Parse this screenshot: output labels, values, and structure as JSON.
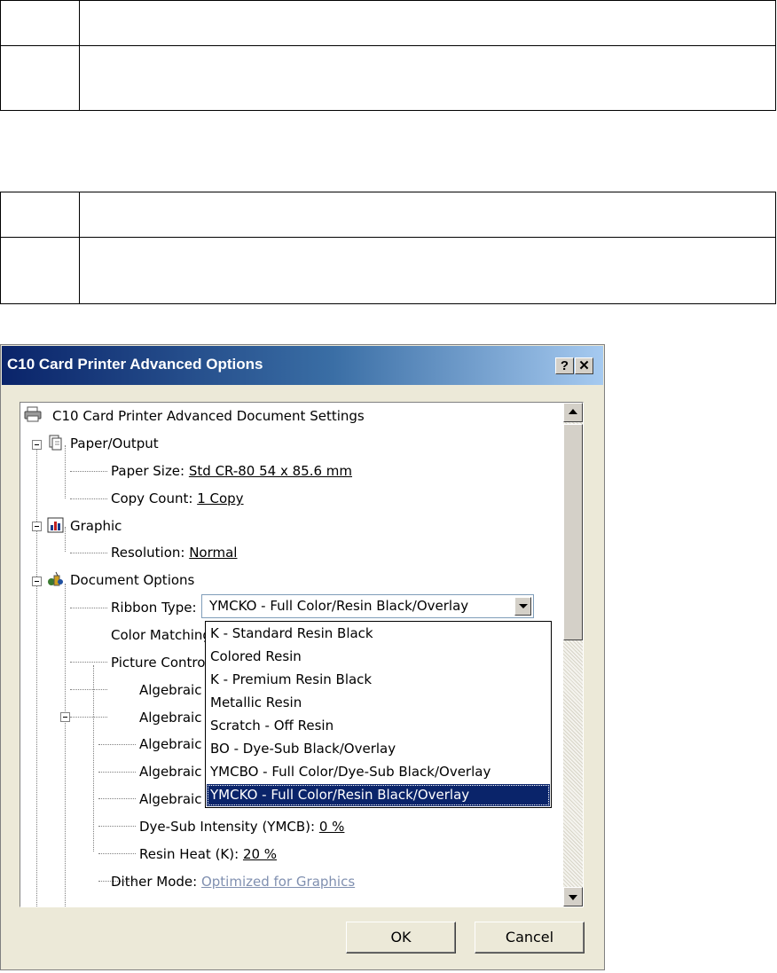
{
  "dialog": {
    "title": "C10 Card Printer Advanced Options",
    "help_label": "?",
    "close_label": "✕",
    "ok_label": "OK",
    "cancel_label": "Cancel"
  },
  "tree": {
    "root": "C10 Card Printer Advanced Document Settings",
    "paper_output": "Paper/Output",
    "paper_size_label": "Paper Size: ",
    "paper_size_value": "Std CR-80  54 x 85.6 mm",
    "copy_count_label": "Copy Count: ",
    "copy_count_value": "1 Copy",
    "graphic": "Graphic",
    "resolution_label": "Resolution: ",
    "resolution_value": "Normal",
    "document_options": "Document Options",
    "ribbon_type_label": "Ribbon Type:",
    "color_matching_label": "Color Matching",
    "picture_control_label": "Picture Control",
    "algebraic_items": [
      "Algebraic C",
      "Algebraic G",
      "Algebraic Y",
      "Algebraic M",
      "Algebraic C"
    ],
    "dye_sub_label": "Dye-Sub Intensity (YMCB): ",
    "dye_sub_value": "0 %",
    "resin_heat_label": "Resin Heat (K): ",
    "resin_heat_value": "20 %",
    "dither_label": "Dither Mode: ",
    "dither_value": "Optimized for Graphics"
  },
  "ribbon_combo": {
    "value": "YMCKO - Full Color/Resin Black/Overlay",
    "options": [
      "K - Standard Resin Black",
      "Colored Resin",
      "K - Premium Resin Black",
      "Metallic Resin",
      "Scratch - Off Resin",
      "BO - Dye-Sub Black/Overlay",
      "YMCBO - Full Color/Dye-Sub Black/Overlay",
      "YMCKO - Full Color/Resin Black/Overlay"
    ],
    "selected_index": 7
  },
  "colors": {
    "title_bar": "#0a246a",
    "selection": "#0a246a",
    "dialog_face": "#ece9d8"
  }
}
